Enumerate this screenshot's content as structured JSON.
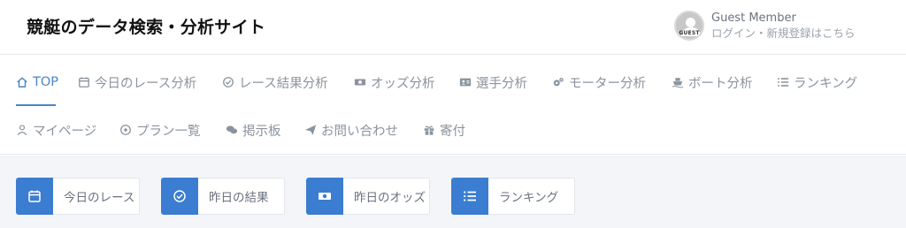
{
  "header": {
    "site_title": "競艇のデータ検索・分析サイト",
    "avatar_label": "GUEST",
    "user_name": "Guest Member",
    "login_link": "ログイン・新規登録はこちら"
  },
  "nav": {
    "row1": [
      {
        "label": "TOP",
        "icon": "home-icon",
        "active": true
      },
      {
        "label": "今日のレース分析",
        "icon": "calendar-icon"
      },
      {
        "label": "レース結果分析",
        "icon": "check-circle-icon"
      },
      {
        "label": "オッズ分析",
        "icon": "money-icon"
      },
      {
        "label": "選手分析",
        "icon": "id-card-icon"
      },
      {
        "label": "モーター分析",
        "icon": "cogs-icon"
      },
      {
        "label": "ボート分析",
        "icon": "ship-icon"
      },
      {
        "label": "ランキング",
        "icon": "list-icon"
      }
    ],
    "row2": [
      {
        "label": "マイページ",
        "icon": "user-icon"
      },
      {
        "label": "プラン一覧",
        "icon": "target-icon"
      },
      {
        "label": "掲示板",
        "icon": "comments-icon"
      },
      {
        "label": "お問い合わせ",
        "icon": "paper-plane-icon"
      },
      {
        "label": "寄付",
        "icon": "gift-icon"
      }
    ]
  },
  "quick_links": [
    {
      "label": "今日のレース",
      "icon": "calendar-icon"
    },
    {
      "label": "昨日の結果",
      "icon": "check-circle-icon"
    },
    {
      "label": "昨日のオッズ",
      "icon": "money-icon"
    },
    {
      "label": "ランキング",
      "icon": "list-icon"
    }
  ],
  "colors": {
    "accent": "#4a84c7",
    "quick_icon_bg": "#3b7dd0",
    "nav_text": "#8a949e",
    "main_bg": "#f3f5f9"
  }
}
